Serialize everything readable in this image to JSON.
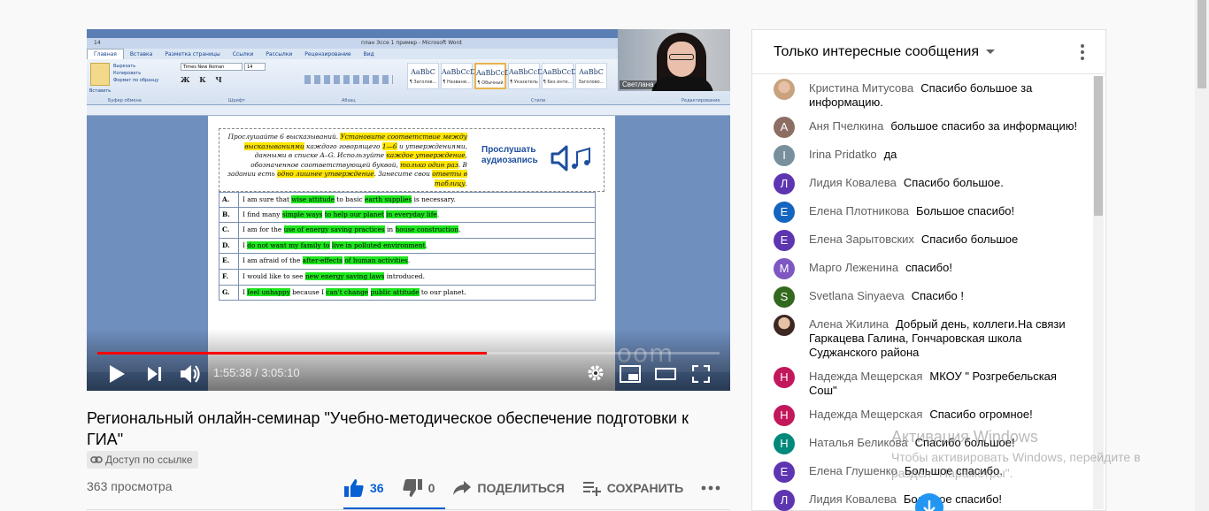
{
  "video": {
    "word": {
      "doc_title": "план Эссе 1 пример - Microsoft Word",
      "tabs": [
        "Главная",
        "Вставка",
        "Разметка страницы",
        "Ссылки",
        "Рассылки",
        "Рецензирование",
        "Вид"
      ],
      "font_name": "Times New Roman",
      "font_size": "14",
      "clipboard_items": [
        "Вырезать",
        "Копировать",
        "Формат по образцу"
      ],
      "paste_label": "Вставить",
      "group_labels": [
        "Буфер обмена",
        "Шрифт",
        "Абзац",
        "Стили",
        "Редактирование"
      ],
      "styles": [
        {
          "sample": "AaBbC",
          "name": "¶ Заголов..."
        },
        {
          "sample": "AaBbCcD",
          "name": "¶ Названи..."
        },
        {
          "sample": "AaBbCcDc",
          "name": "¶ Обычный"
        },
        {
          "sample": "AaBbCcDc",
          "name": "¶ Указатель"
        },
        {
          "sample": "AaBbCcDc",
          "name": "¶ Без инте..."
        },
        {
          "sample": "AaBbC",
          "name": "Заголово..."
        }
      ]
    },
    "task": {
      "part1": "Прослушайте 6 высказываний. ",
      "hl1": "Установите соответствие между высказываниями",
      "part2": " каждого говорящего ",
      "hl2": "1—6",
      "part3": " и утверждениями, данными в списке А–G. Используйте ",
      "hl3": "каждое утверждение",
      "part4": ", обозначенное соответствующей буквой, ",
      "hl4": "только один раз",
      "part5": ". В задании есть ",
      "hl5": "одно лишнее утверждение",
      "part6": ". Занесите свои ",
      "hl6": "ответы в таблицу",
      "part7": ".",
      "audio_label_1": "Прослушать",
      "audio_label_2": "аудиозапись"
    },
    "statements": [
      {
        "letter": "A.",
        "segments": [
          {
            "t": "I am sure that ",
            "h": false
          },
          {
            "t": "wise attitude",
            "h": true
          },
          {
            "t": " to basic ",
            "h": false
          },
          {
            "t": "earth supplies",
            "h": true
          },
          {
            "t": " is necessary.",
            "h": false
          }
        ]
      },
      {
        "letter": "B.",
        "segments": [
          {
            "t": "I find many ",
            "h": false
          },
          {
            "t": "simple ways",
            "h": true
          },
          {
            "t": " ",
            "h": false
          },
          {
            "t": "to help our planet",
            "h": true
          },
          {
            "t": " ",
            "h": false
          },
          {
            "t": "in everyday life",
            "h": true
          },
          {
            "t": ".",
            "h": false
          }
        ]
      },
      {
        "letter": "C.",
        "segments": [
          {
            "t": "I am for the ",
            "h": false
          },
          {
            "t": "use of energy saving practices",
            "h": true
          },
          {
            "t": " in ",
            "h": false
          },
          {
            "t": "house construction",
            "h": true
          },
          {
            "t": ".",
            "h": false
          }
        ]
      },
      {
        "letter": "D.",
        "segments": [
          {
            "t": "I ",
            "h": false
          },
          {
            "t": "do not want my family to",
            "h": true
          },
          {
            "t": " ",
            "h": false
          },
          {
            "t": "live in polluted environment",
            "h": true
          },
          {
            "t": ".",
            "h": false
          }
        ]
      },
      {
        "letter": "E.",
        "segments": [
          {
            "t": "I am afraid of the ",
            "h": false
          },
          {
            "t": "after-effects",
            "h": true
          },
          {
            "t": " ",
            "h": false
          },
          {
            "t": "of human activities",
            "h": true
          },
          {
            "t": ".",
            "h": false
          }
        ]
      },
      {
        "letter": "F.",
        "segments": [
          {
            "t": "I would like to see ",
            "h": false
          },
          {
            "t": "new energy saving laws",
            "h": true
          },
          {
            "t": " introduced.",
            "h": false
          }
        ]
      },
      {
        "letter": "G.",
        "segments": [
          {
            "t": "I ",
            "h": false
          },
          {
            "t": "feel unhappy",
            "h": true
          },
          {
            "t": " because I ",
            "h": false
          },
          {
            "t": "can't change",
            "h": true
          },
          {
            "t": " ",
            "h": false
          },
          {
            "t": "public attitude",
            "h": true
          },
          {
            "t": " to our planet.",
            "h": false
          }
        ]
      }
    ],
    "webcam_name": "Светлана",
    "watermark": "zoom",
    "current_time": "1:55:38",
    "duration": "3:05:10",
    "time_display": "1:55:38 / 3:05:10",
    "progress_fraction": 0.626
  },
  "meta": {
    "title": "Региональный онлайн-семинар \"Учебно-методическое обеспечение подготовки к ГИА\"",
    "access_label": "Доступ по ссылке",
    "views": "363 просмотра",
    "likes": "36",
    "dislikes": "0",
    "share_label": "ПОДЕЛИТЬСЯ",
    "save_label": "СОХРАНИТЬ"
  },
  "chat": {
    "mode_label": "Только интересные сообщения",
    "messages": [
      {
        "author": "Кристина Митусова",
        "text": "Спасибо большое за информацию.",
        "avatar": "",
        "color": "#c9a27e",
        "photo": true
      },
      {
        "author": "Аня Пчелкина",
        "text": "большое спасибо за информацию!",
        "avatar": "А",
        "color": "#8d6e63"
      },
      {
        "author": "Irina Pridatko",
        "text": "да",
        "avatar": "I",
        "color": "#78909c"
      },
      {
        "author": "Лидия Ковалева",
        "text": "Спасибо большое.",
        "avatar": "Л",
        "color": "#5e35b1"
      },
      {
        "author": "Елена Плотникова",
        "text": "Большое спасибо!",
        "avatar": "Е",
        "color": "#1565c0"
      },
      {
        "author": "Елена Зарытовских",
        "text": "Спасибо большое",
        "avatar": "Е",
        "color": "#5e35b1"
      },
      {
        "author": "Марго Леженина",
        "text": "спасибо!",
        "avatar": "М",
        "color": "#7e57c2"
      },
      {
        "author": "Svetlana Sinyaeva",
        "text": "Спасибо !",
        "avatar": "S",
        "color": "#33691e"
      },
      {
        "author": "Алена Жилина",
        "text": "Добрый день, коллеги.На связи Гаркацева Галина, Гончаровская школа Суджанского района",
        "avatar": "",
        "color": "#3e2723",
        "photo": true
      },
      {
        "author": "Надежда Мещерская",
        "text": "МКОУ \" Розгребельская Сош\"",
        "avatar": "Н",
        "color": "#c2185b"
      },
      {
        "author": "Надежда Мещерская",
        "text": "Спасибо огромное!",
        "avatar": "Н",
        "color": "#c2185b"
      },
      {
        "author": "Наталья Беликова",
        "text": "Спасибо большое!",
        "avatar": "Н",
        "color": "#00897b"
      },
      {
        "author": "Елена Глушенко",
        "text": "Большое спасибо.",
        "avatar": "Е",
        "color": "#5e35b1"
      },
      {
        "author": "Лидия Ковалева",
        "text": "Большое спасибо!",
        "avatar": "Л",
        "color": "#5e35b1"
      }
    ]
  },
  "windows": {
    "heading": "Активация Windows",
    "subtext": "Чтобы активировать Windows, перейдите в раздел \"Параметры\"."
  },
  "colors": {
    "like_blue": "#065fd4",
    "progress_red": "#ff0000",
    "word_highlight_yellow": "#ffe600",
    "word_highlight_green": "#1ee61e"
  }
}
